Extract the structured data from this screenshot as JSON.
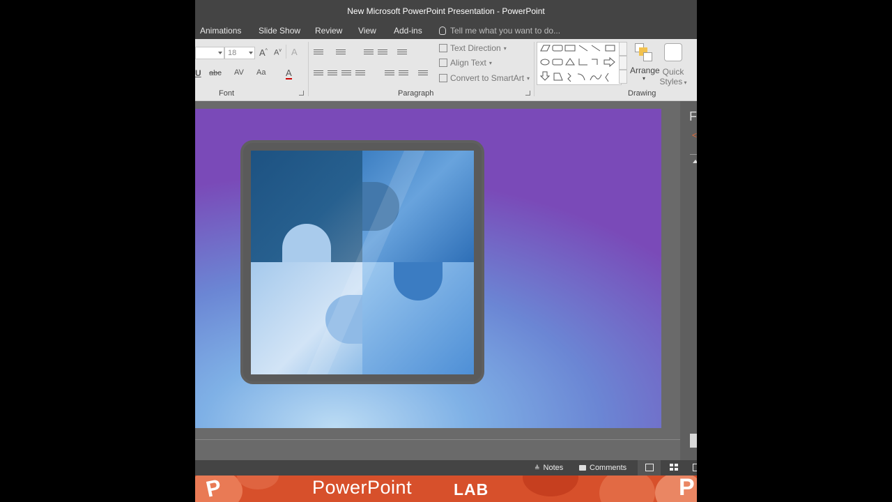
{
  "window": {
    "title": "New Microsoft PowerPoint Presentation - PowerPoint"
  },
  "tabs": [
    "Animations",
    "Slide Show",
    "Review",
    "View",
    "Add-ins"
  ],
  "tell_me": {
    "placeholder": "Tell me what you want to do..."
  },
  "ribbon": {
    "font_group": {
      "label": "Font",
      "font_size": "18",
      "bold_hint": "U",
      "strike_hint": "abc",
      "spacing_hint": "AV",
      "case_hint": "Aa",
      "color_hint": "A"
    },
    "paragraph_group": {
      "label": "Paragraph",
      "text_direction": "Text Direction",
      "align_text": "Align Text",
      "convert_smartart": "Convert to SmartArt"
    },
    "drawing_group": {
      "label": "Drawing",
      "arrange": "Arrange",
      "quick_styles_line1": "Quick",
      "quick_styles_line2": "Styles"
    }
  },
  "right_pane": {
    "heading_char": "F"
  },
  "status_bar": {
    "notes": "Notes",
    "comments": "Comments"
  },
  "banner": {
    "title": "PowerPoint",
    "suffix": "LAB",
    "logo_letter": "P"
  },
  "colors": {
    "accent": "#d7502b",
    "chrome": "#444444",
    "ribbon": "#e6e6e6"
  }
}
